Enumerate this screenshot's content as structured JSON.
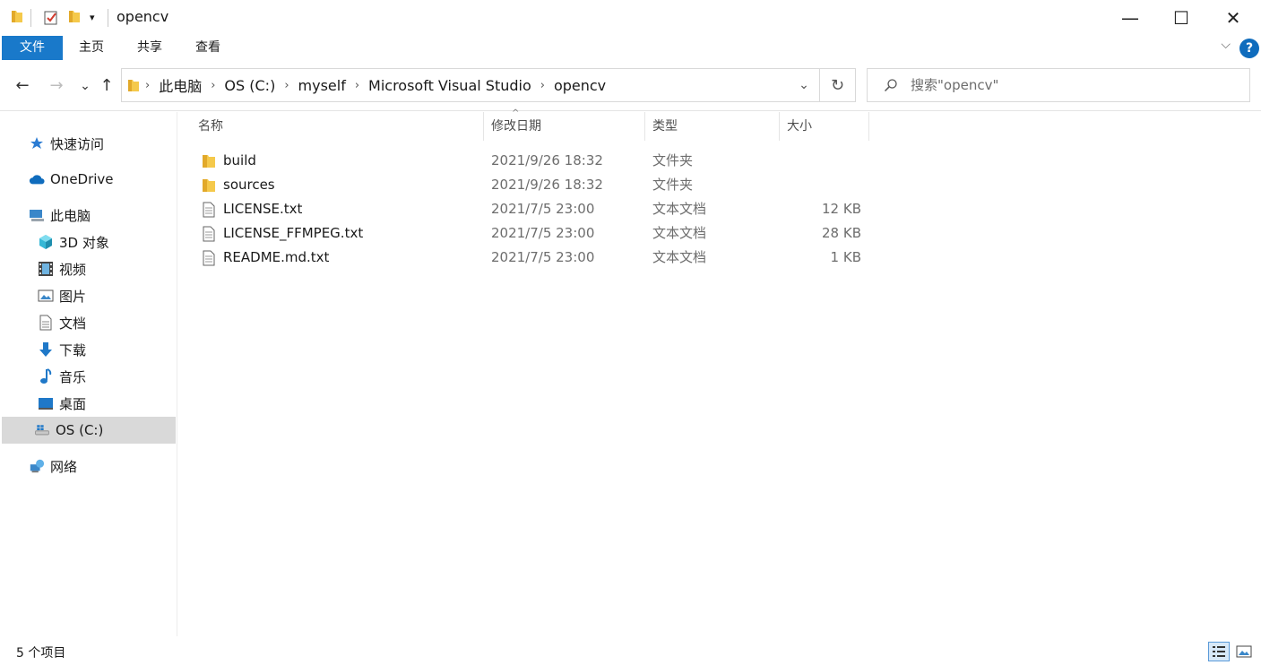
{
  "window": {
    "title": "opencv",
    "minimize_glyph": "—",
    "maximize_glyph": "☐",
    "close_glyph": "✕"
  },
  "ribbon": {
    "tabs": [
      {
        "label": "文件",
        "active": true
      },
      {
        "label": "主页"
      },
      {
        "label": "共享"
      },
      {
        "label": "查看"
      }
    ],
    "help_label": "?",
    "collapse_glyph": "⌵"
  },
  "nav": {
    "back_glyph": "←",
    "forward_glyph": "→",
    "recent_glyph": "⌄",
    "up_glyph": "↑"
  },
  "address": {
    "crumbs": [
      "此电脑",
      "OS (C:)",
      "myself",
      "Microsoft Visual Studio",
      "opencv"
    ],
    "separator": "›",
    "dropdown_glyph": "⌄",
    "refresh_glyph": "↻"
  },
  "search": {
    "placeholder": "搜索\"opencv\""
  },
  "sidebar": {
    "items": [
      {
        "label": "快速访问",
        "icon": "star-icon"
      },
      {
        "label": "OneDrive",
        "icon": "cloud-icon"
      },
      {
        "label": "此电脑",
        "icon": "computer-icon"
      },
      {
        "label": "3D 对象",
        "icon": "cube-icon"
      },
      {
        "label": "视频",
        "icon": "film-icon"
      },
      {
        "label": "图片",
        "icon": "picture-icon"
      },
      {
        "label": "文档",
        "icon": "document-icon"
      },
      {
        "label": "下载",
        "icon": "download-icon"
      },
      {
        "label": "音乐",
        "icon": "music-icon"
      },
      {
        "label": "桌面",
        "icon": "desktop-icon"
      },
      {
        "label": "OS (C:)",
        "icon": "drive-icon",
        "selected": true
      },
      {
        "label": "网络",
        "icon": "network-icon"
      }
    ]
  },
  "columns": {
    "name": "名称",
    "date": "修改日期",
    "type": "类型",
    "size": "大小"
  },
  "files": [
    {
      "name": "build",
      "date": "2021/9/26 18:32",
      "type": "文件夹",
      "size": "",
      "icon": "folder-icon"
    },
    {
      "name": "sources",
      "date": "2021/9/26 18:32",
      "type": "文件夹",
      "size": "",
      "icon": "folder-icon"
    },
    {
      "name": "LICENSE.txt",
      "date": "2021/7/5 23:00",
      "type": "文本文档",
      "size": "12 KB",
      "icon": "text-file-icon"
    },
    {
      "name": "LICENSE_FFMPEG.txt",
      "date": "2021/7/5 23:00",
      "type": "文本文档",
      "size": "28 KB",
      "icon": "text-file-icon"
    },
    {
      "name": "README.md.txt",
      "date": "2021/7/5 23:00",
      "type": "文本文档",
      "size": "1 KB",
      "icon": "text-file-icon"
    }
  ],
  "status": {
    "item_count": "5 个项目"
  },
  "colors": {
    "accent": "#1979ca",
    "folder": "#f5c94b",
    "selected_bg": "#d9d9d9"
  }
}
